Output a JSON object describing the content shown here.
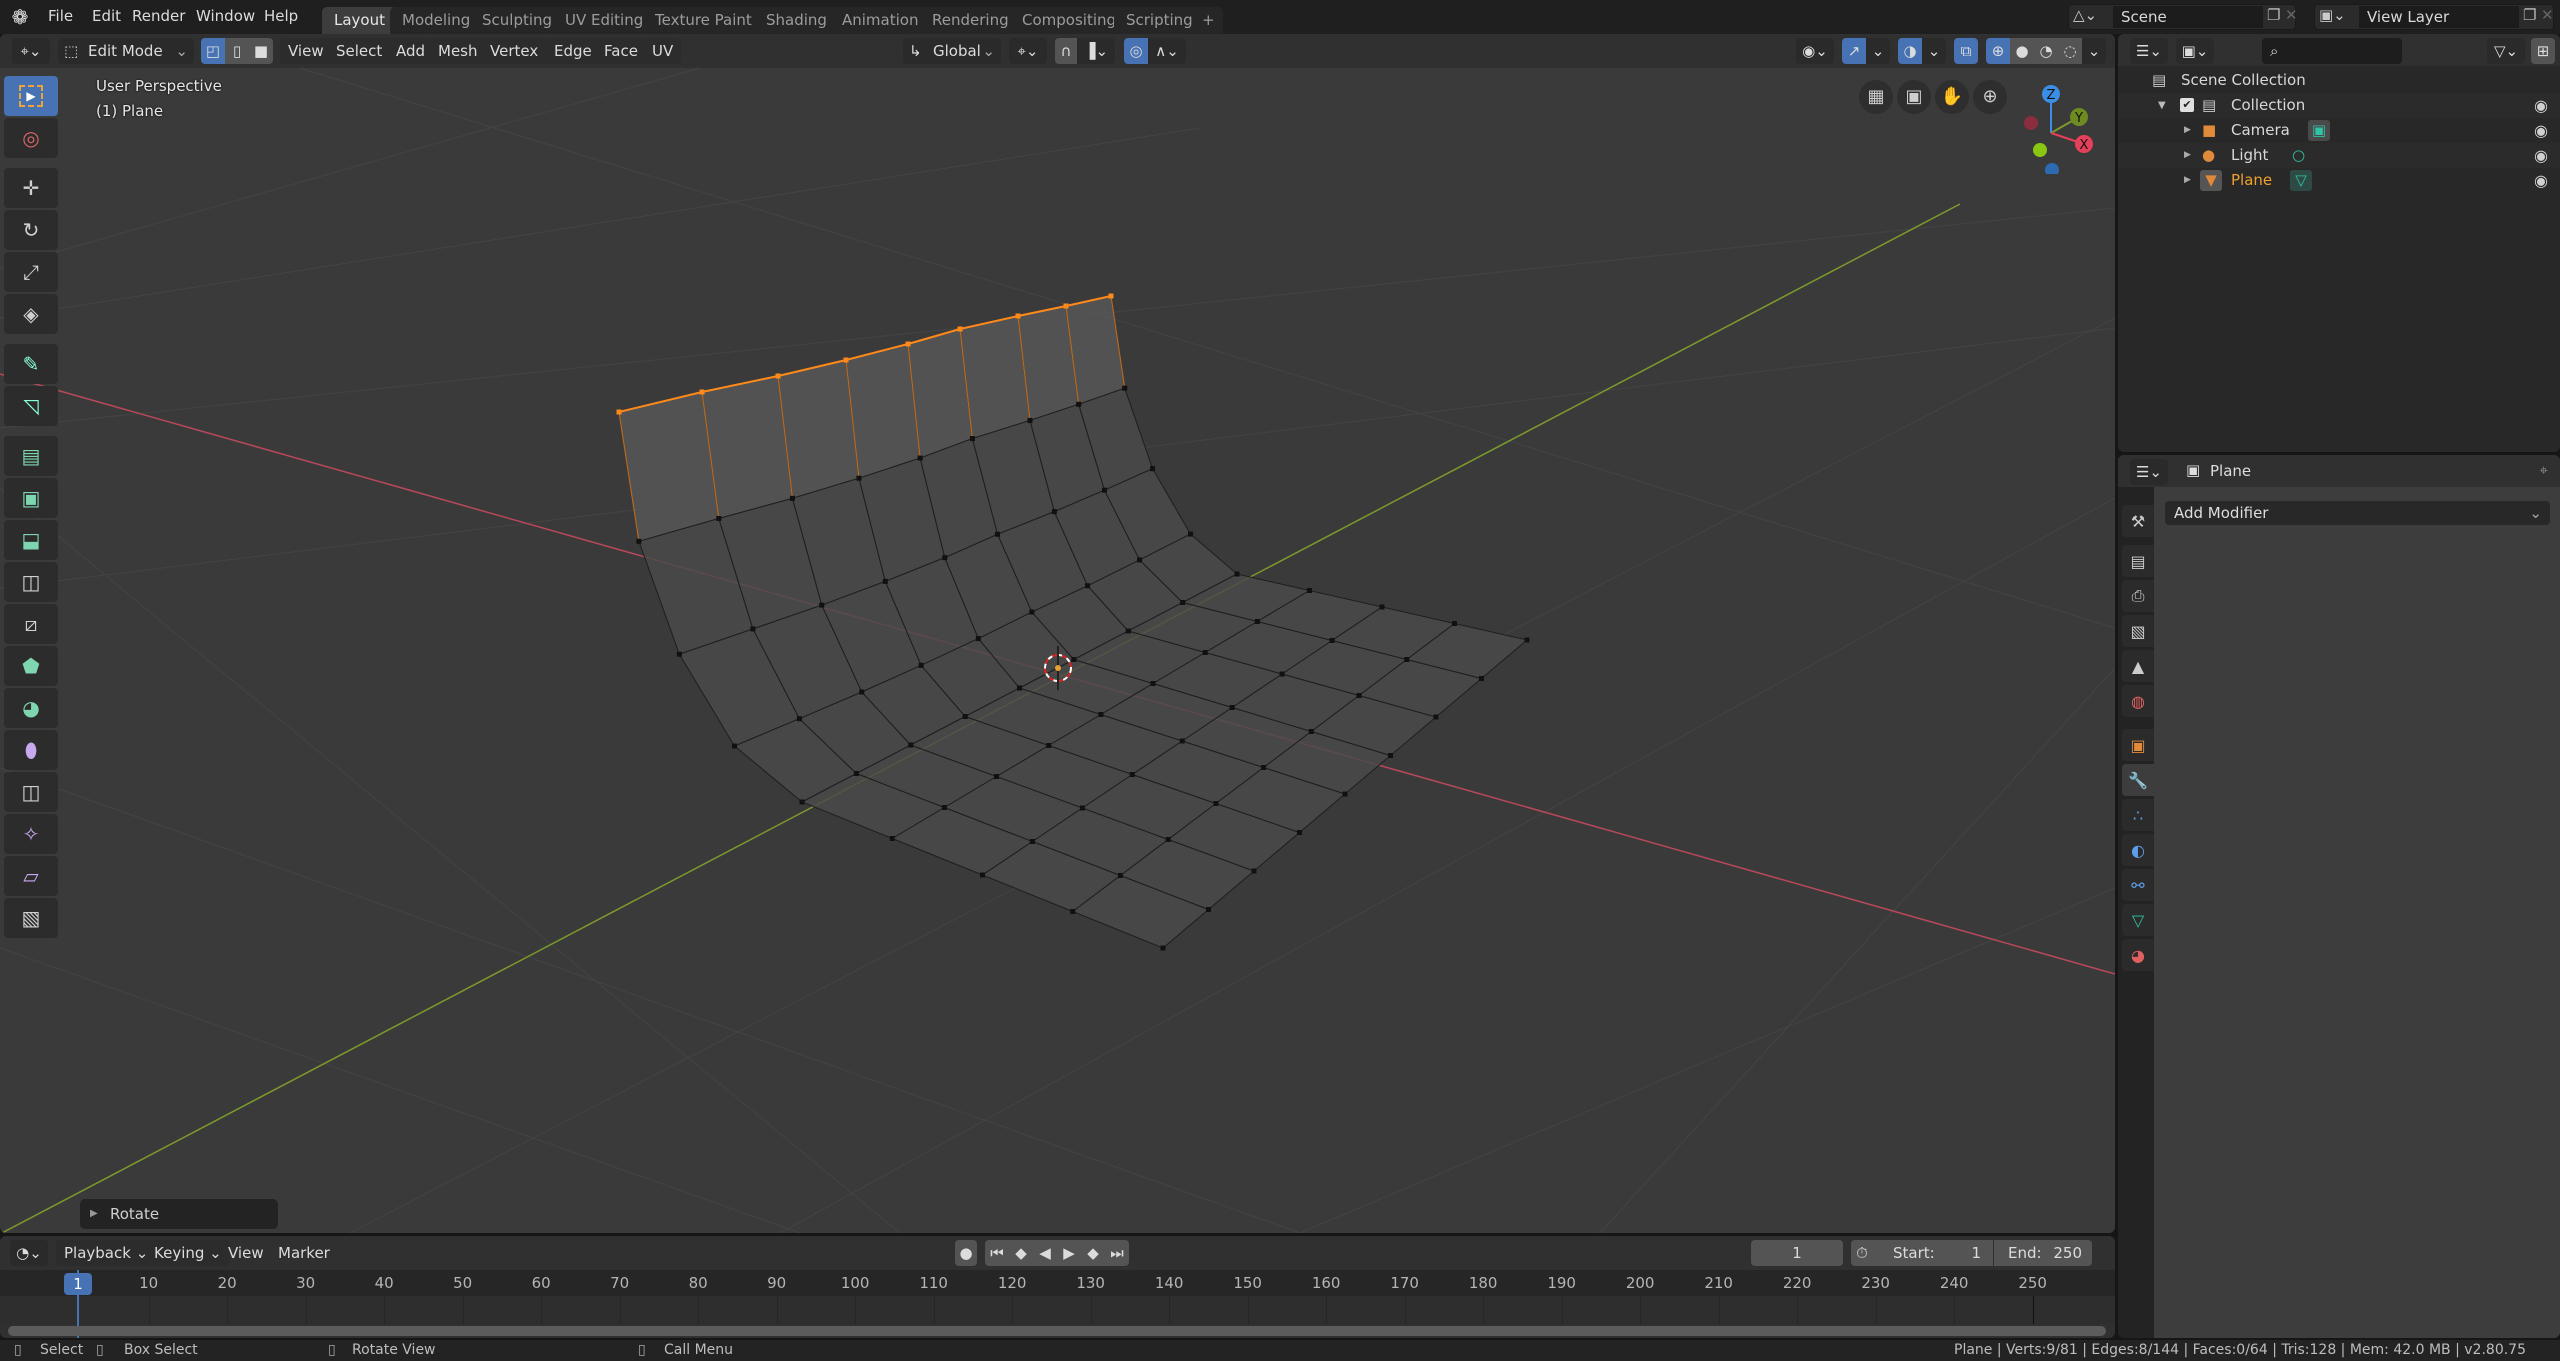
{
  "topbar": {
    "menus": [
      "File",
      "Edit",
      "Render",
      "Window",
      "Help"
    ],
    "workspaces": [
      "Layout",
      "Modeling",
      "Sculpting",
      "UV Editing",
      "Texture Paint",
      "Shading",
      "Animation",
      "Rendering",
      "Compositing",
      "Scripting"
    ],
    "active_workspace": "Layout",
    "add_workspace": "+",
    "scene": "Scene",
    "view_layer": "View Layer"
  },
  "viewport": {
    "mode": "Edit Mode",
    "menus": [
      "View",
      "Select",
      "Add",
      "Mesh",
      "Vertex",
      "Edge",
      "Face",
      "UV"
    ],
    "transform_orientation": "Global",
    "select_mode": "vertex",
    "view_label": "User Perspective",
    "object_label": "(1) Plane",
    "last_operator": "Rotate",
    "gizmo_axes": [
      "Z",
      "Y",
      "X"
    ],
    "colors": {
      "x_axis": "#b8485a",
      "y_axis": "#7c9a2c",
      "selected": "#ff8a1a",
      "accent": "#4772b3"
    }
  },
  "toolbar": {
    "tools": [
      "select-box",
      "cursor",
      "move",
      "rotate",
      "scale",
      "transform",
      "annotate",
      "measure",
      "extrude-region",
      "inset-faces",
      "bevel",
      "loop-cut",
      "knife",
      "poly-build",
      "spin",
      "smooth",
      "edge-slide",
      "shrink-fatten",
      "shear",
      "rip-region"
    ]
  },
  "outliner": {
    "root": "Scene Collection",
    "collection": "Collection",
    "items": [
      {
        "name": "Camera",
        "type": "camera"
      },
      {
        "name": "Light",
        "type": "light"
      },
      {
        "name": "Plane",
        "type": "mesh",
        "active": true
      }
    ]
  },
  "properties": {
    "context": "Plane",
    "active_tab": "modifiers",
    "add_modifier": "Add Modifier",
    "tabs": [
      "tool",
      "render",
      "output",
      "view-layer",
      "scene",
      "world",
      "object",
      "modifiers",
      "particles",
      "physics",
      "constraints",
      "data",
      "material"
    ]
  },
  "timeline": {
    "menus": [
      "Playback",
      "Keying",
      "View",
      "Marker"
    ],
    "current_frame": "1",
    "start_label": "Start:",
    "start": "1",
    "end_label": "End:",
    "end": "250",
    "ticks": [
      "10",
      "20",
      "30",
      "40",
      "50",
      "60",
      "70",
      "80",
      "90",
      "100",
      "110",
      "120",
      "130",
      "140",
      "150",
      "160",
      "170",
      "180",
      "190",
      "200",
      "210",
      "220",
      "230",
      "240",
      "250"
    ]
  },
  "statusbar": {
    "select": "Select",
    "box_select": "Box Select",
    "rotate_view": "Rotate View",
    "call_menu": "Call Menu",
    "stats": "Plane | Verts:9/81 | Edges:8/144 | Faces:0/64 | Tris:128 | Mem: 42.0 MB | v2.80.75"
  }
}
